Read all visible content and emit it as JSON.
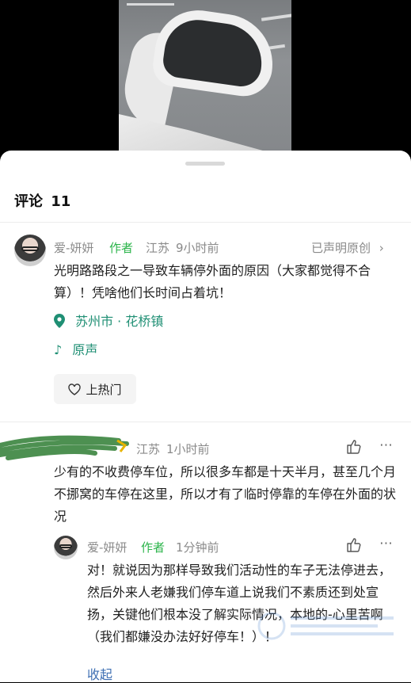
{
  "comments_header": {
    "label": "评论",
    "count": "11"
  },
  "post": {
    "username": "爱-妍妍",
    "author_tag": "作者",
    "region": "江苏",
    "time": "9小时前",
    "declared": "已声明原创",
    "text": "光明路路段之一导致车辆停外面的原因（大家都觉得不合算）！凭啥他们长时间占着坑！",
    "location": "苏州市 · 花桥镇",
    "audio": "原声",
    "hot_button": "上热门"
  },
  "comment": {
    "region": "江苏",
    "time": "1小时前",
    "text": "少有的不收费停车位，所以很多车都是十天半月，甚至几个月不挪窝的车停在这里，所以才有了临时停靠的车停在外面的状况"
  },
  "reply": {
    "username": "爱-妍妍",
    "author_tag": "作者",
    "time": "1分钟前",
    "text": "对！就说因为那样导致我们活动性的车子无法停进去，然后外来人老嫌我们停车道上说我们不素质还到处宣扬，关键他们根本没了解实际情况，本地的-心里苦啊（我们都嫌没办法好好停车！）！",
    "collapse": "收起"
  }
}
